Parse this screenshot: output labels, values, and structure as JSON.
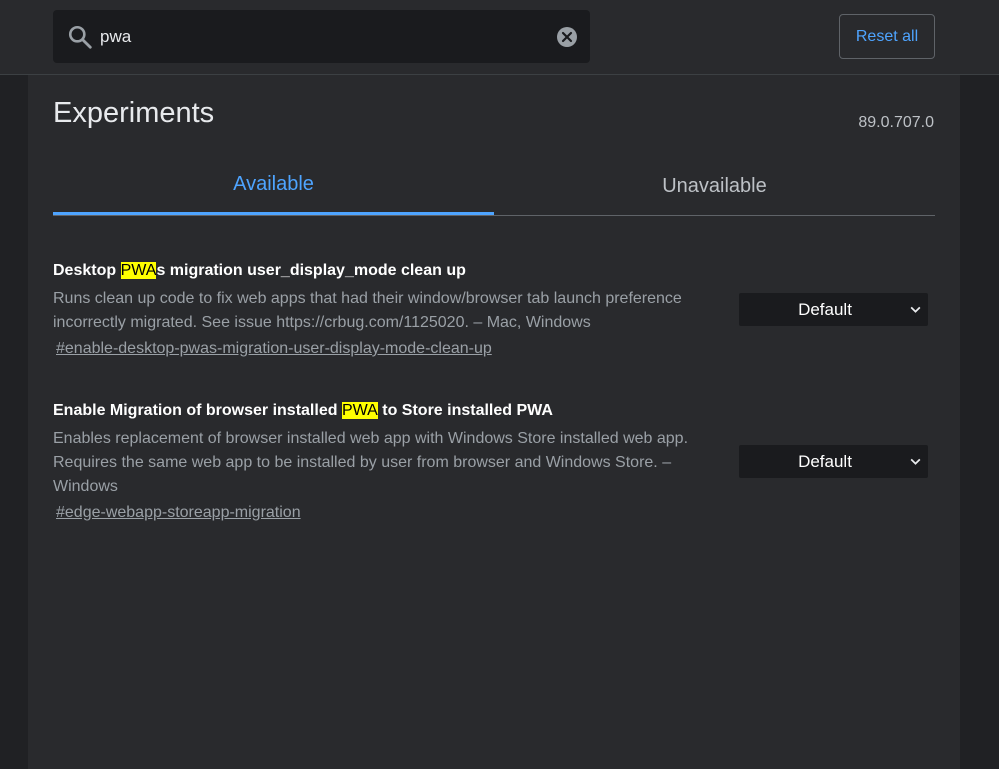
{
  "search": {
    "value": "pwa"
  },
  "header": {
    "reset_label": "Reset all"
  },
  "page": {
    "title": "Experiments",
    "version": "89.0.707.0"
  },
  "tabs": [
    {
      "label": "Available",
      "selected": true
    },
    {
      "label": "Unavailable",
      "selected": false
    }
  ],
  "experiments": [
    {
      "title_before": "Desktop ",
      "title_highlight": "PWA",
      "title_after": "s migration user_display_mode clean up",
      "description": "Runs clean up code to fix web apps that had their window/browser tab launch preference incorrectly migrated. See issue https://crbug.com/1125020. – Mac, Windows",
      "link": "#enable-desktop-pwas-migration-user-display-mode-clean-up",
      "select_value": "Default"
    },
    {
      "title_before": "Enable Migration of browser installed ",
      "title_highlight": "PWA",
      "title_after": " to Store installed PWA",
      "description": "Enables replacement of browser installed web app with Windows Store installed web app. Requires the same web app to be installed by user from browser and Windows Store. – Windows",
      "link": "#edge-webapp-storeapp-migration",
      "select_value": "Default"
    }
  ],
  "colors": {
    "accent": "#4ea4ff",
    "highlight": "#ffff00",
    "background": "#202124",
    "panel": "#292a2d"
  },
  "icons": {
    "search": "search-icon",
    "clear": "clear-icon",
    "dropdown": "chevron-down-icon"
  }
}
